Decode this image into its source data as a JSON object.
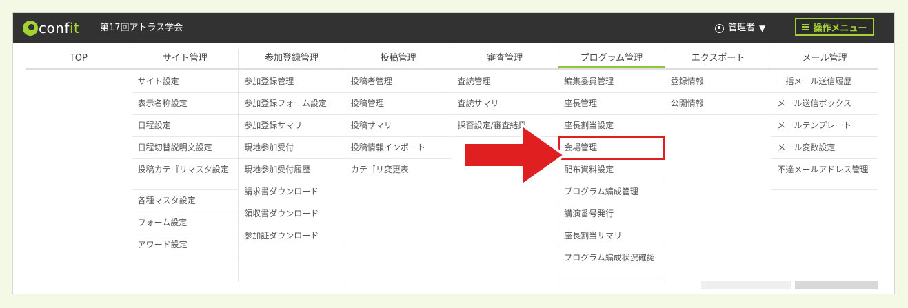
{
  "header": {
    "logo_prefix": "conf",
    "logo_suffix": "it",
    "conference_name": "第17回アトラス学会",
    "admin_label": "管理者",
    "caret": "▼",
    "operation_menu_label": "操作メニュー",
    "accent_color": "#a4d233"
  },
  "nav": {
    "tabs": [
      {
        "label": "TOP"
      },
      {
        "label": "サイト管理"
      },
      {
        "label": "参加登録管理"
      },
      {
        "label": "投稿管理"
      },
      {
        "label": "審査管理"
      },
      {
        "label": "プログラム管理"
      },
      {
        "label": "エクスポート"
      },
      {
        "label": "メール管理"
      }
    ],
    "active_tab": "プログラム管理"
  },
  "columns": {
    "site": [
      "サイト設定",
      "表示名称設定",
      "日程設定",
      "日程切替説明文設定",
      "投稿カテゴリマスタ設定",
      "各種マスタ設定",
      "フォーム設定",
      "アワード設定"
    ],
    "registration": [
      "参加登録管理",
      "参加登録フォーム設定",
      "参加登録サマリ",
      "現地参加受付",
      "現地参加受付履歴",
      "請求書ダウンロード",
      "領収書ダウンロード",
      "参加証ダウンロード"
    ],
    "submission": [
      "投稿者管理",
      "投稿管理",
      "投稿サマリ",
      "投稿情報インポート",
      "カテゴリ変更表"
    ],
    "review": [
      "査読管理",
      "査読サマリ",
      "採否設定/審査結果"
    ],
    "program": [
      "編集委員管理",
      "座長管理",
      "座長割当設定",
      "会場管理",
      "配布資料設定",
      "プログラム編成管理",
      "講演番号発行",
      "座長割当サマリ",
      "プログラム編成状況確認"
    ],
    "export": [
      "登録情報",
      "公開情報"
    ],
    "mail": [
      "一括メール送信履歴",
      "メール送信ボックス",
      "メールテンプレート",
      "メール変数設定",
      "不達メールアドレス管理"
    ]
  },
  "highlighted_item": "会場管理",
  "annotation_color": "#e02020"
}
